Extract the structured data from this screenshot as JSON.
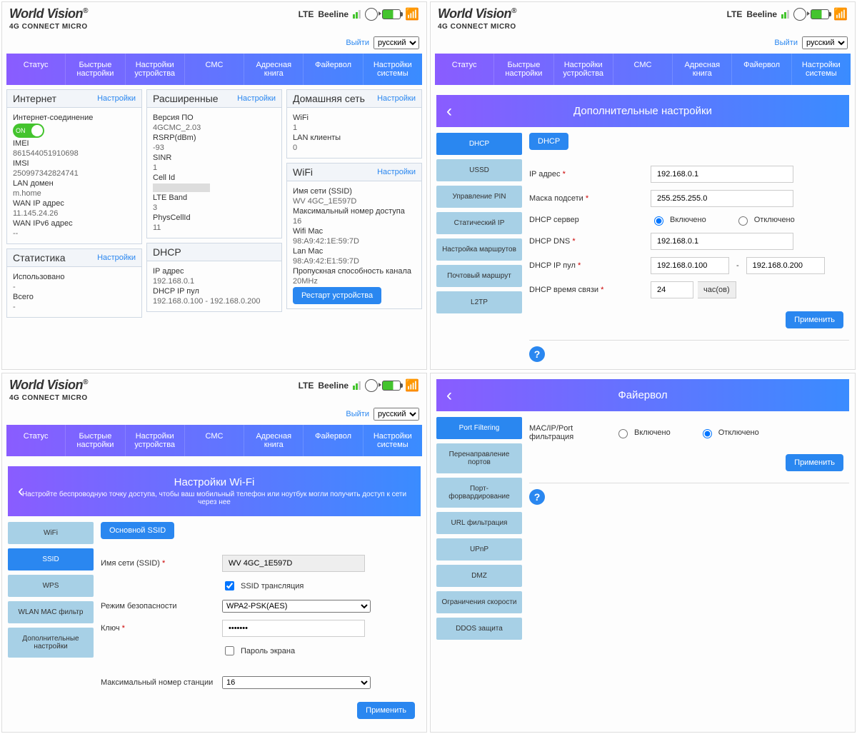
{
  "brand": "World Vision",
  "model": "4G CONNECT MICRO",
  "carrier_prefix": "LTE",
  "carrier": "Beeline",
  "logout": "Выйти",
  "lang_sel": "русский",
  "tabs": [
    "Статус",
    "Быстрые настройки",
    "Настройки устройства",
    "СМС",
    "Адресная книга",
    "Файервол",
    "Настройки системы"
  ],
  "settings_label": "Настройки",
  "p1": {
    "cards": {
      "inet": {
        "title": "Интернет",
        "conn": "Интернет-соединение",
        "toggle": "ON",
        "items": [
          {
            "k": "IMEI",
            "v": "861544051910698"
          },
          {
            "k": "IMSI",
            "v": "250997342824741"
          },
          {
            "k": "LAN домен",
            "v": "m.home"
          },
          {
            "k": "WAN IP адрес",
            "v": "11.145.24.26"
          },
          {
            "k": "WAN IPv6 адрес",
            "v": "--"
          }
        ]
      },
      "stats": {
        "title": "Статистика",
        "items": [
          {
            "k": "Использовано",
            "v": "-"
          },
          {
            "k": "Всего",
            "v": "-"
          }
        ]
      },
      "adv": {
        "title": "Расширенные",
        "items": [
          {
            "k": "Версия ПО",
            "v": "4GCMC_2.03"
          },
          {
            "k": "RSRP(dBm)",
            "v": "-93"
          },
          {
            "k": "SINR",
            "v": "1"
          },
          {
            "k": "Cell Id",
            "v": ""
          },
          {
            "k": "LTE Band",
            "v": "3"
          },
          {
            "k": "PhysCellId",
            "v": "11"
          }
        ]
      },
      "dhcp": {
        "title": "DHCP",
        "items": [
          {
            "k": "IP адрес",
            "v": "192.168.0.1"
          },
          {
            "k": "DHCP IP пул",
            "v": "192.168.0.100    -   192.168.0.200"
          }
        ]
      },
      "home": {
        "title": "Домашняя сеть",
        "items": [
          {
            "k": "WiFi",
            "v": "1"
          },
          {
            "k": "LAN клиенты",
            "v": "0"
          }
        ]
      },
      "wifi": {
        "title": "WiFi",
        "items": [
          {
            "k": "Имя сети (SSID)",
            "v": "WV 4GC_1E597D"
          },
          {
            "k": "Максимальный номер доступа",
            "v": "16"
          },
          {
            "k": "Wifi Mac",
            "v": "98:A9:42:1E:59:7D"
          },
          {
            "k": "Lan Mac",
            "v": "98:A9:42:E1:59:7D"
          },
          {
            "k": "Пропускная способность канала",
            "v": "20MHz"
          }
        ],
        "btn": "Рестарт устройства"
      }
    }
  },
  "p2": {
    "title": "Дополнительные настройки",
    "side": [
      "DHCP",
      "USSD",
      "Управление PIN",
      "Статический IP",
      "Настройка маршрутов",
      "Почтовый маршрут",
      "L2TP"
    ],
    "side_active": 0,
    "pill": "DHCP",
    "fields": {
      "ip_lab": "IP адрес",
      "ip": "192.168.0.1",
      "mask_lab": "Маска подсети",
      "mask": "255.255.255.0",
      "srv_lab": "DHCP сервер",
      "on": "Включено",
      "off": "Отключено",
      "dns_lab": "DHCP DNS",
      "dns": "192.168.0.1",
      "pool_lab": "DHCP IP пул",
      "pool_a": "192.168.0.100",
      "pool_b": "192.168.0.200",
      "lease_lab": "DHCP время связи",
      "lease": "24",
      "hrs": "час(ов)"
    },
    "apply": "Применить"
  },
  "p3": {
    "title": "Настройки Wi-Fi",
    "sub": "Настройте беспроводную точку доступа, чтобы ваш мобильный телефон или ноутбук могли получить доступ к сети через нее",
    "side": [
      "WiFi",
      "SSID",
      "WPS",
      "WLAN MAC фильтр",
      "Дополнительные настройки"
    ],
    "side_active": 1,
    "pill": "Основной SSID",
    "fields": {
      "ssid_lab": "Имя сети (SSID)",
      "ssid": "WV 4GC_1E597D",
      "bcast": "SSID трансляция",
      "sec_lab": "Режим безопасности",
      "sec": "WPA2-PSK(AES)",
      "key_lab": "Ключ",
      "key": "•••••••",
      "showpwd": "Пароль экрана",
      "max_lab": "Максимальный номер станции",
      "max": "16"
    },
    "apply": "Применить"
  },
  "p4": {
    "title": "Файервол",
    "side": [
      "Port Filtering",
      "Перенаправление портов",
      "Порт-форвардирование",
      "URL фильтрация",
      "UPnP",
      "DMZ",
      "Ограничения скорости",
      "DDOS защита"
    ],
    "side_active": 0,
    "fields": {
      "mac_lab": "MAC/IP/Port фильтрация",
      "on": "Включено",
      "off": "Отключено"
    },
    "apply": "Применить"
  }
}
